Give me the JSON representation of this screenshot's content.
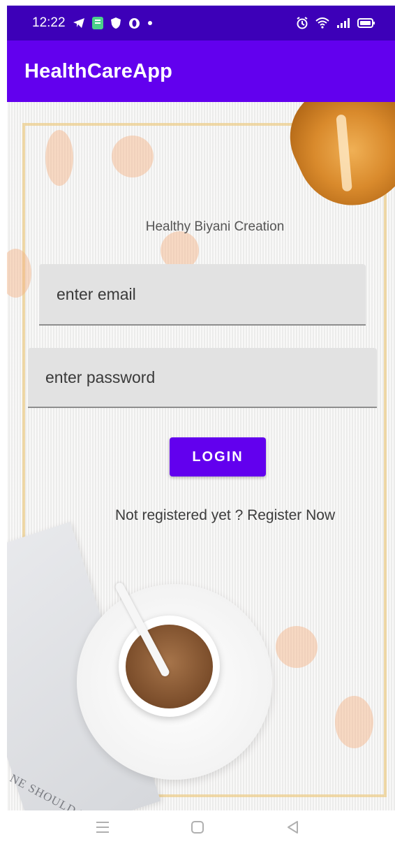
{
  "status_bar": {
    "time": "12:22",
    "left_icons": [
      "telegram-icon",
      "app-notification-icon",
      "shield-icon",
      "opera-icon",
      "dot-icon"
    ],
    "right_icons": [
      "alarm-icon",
      "wifi-icon",
      "signal-icon",
      "battery-icon"
    ]
  },
  "app_bar": {
    "title": "HealthCareApp"
  },
  "login": {
    "brand_title": "Healthy Biyani Creation",
    "email_placeholder": "enter email",
    "password_placeholder": "enter password",
    "login_label": "LOGIN",
    "register_text": "Not registered yet ? Register Now"
  },
  "background": {
    "book_text": "NE SHOULD HAVE A P"
  },
  "nav_bar": {
    "items": [
      "menu-icon",
      "home-icon",
      "back-icon"
    ]
  },
  "colors": {
    "primary": "#6200ee",
    "status_bar": "#3d00b8",
    "field_bg": "#e2e2e2"
  }
}
